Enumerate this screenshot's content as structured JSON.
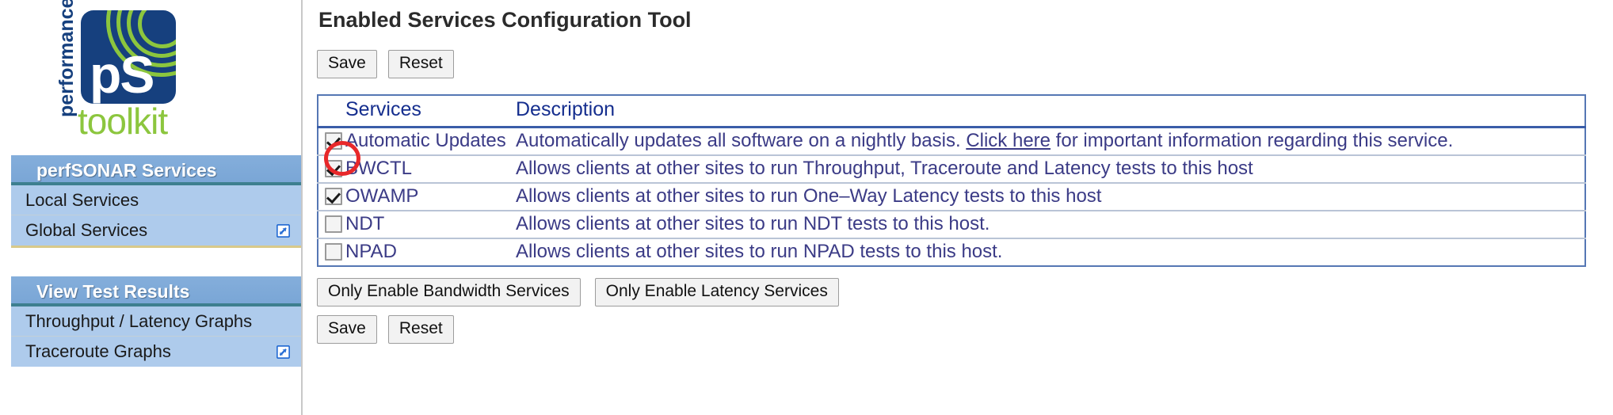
{
  "logo": {
    "vertical_text": "performance",
    "mark_text": "pS",
    "wordmark": "toolkit",
    "colors": {
      "navy": "#16407e",
      "green": "#8cc63e"
    }
  },
  "sidebar": {
    "sections": [
      {
        "header": "perfSONAR Services",
        "items": [
          {
            "label": "Local Services",
            "external": false,
            "icon": ""
          },
          {
            "label": "Global Services",
            "external": true,
            "icon": "external-link-icon"
          }
        ]
      },
      {
        "header": "View Test Results",
        "items": [
          {
            "label": "Throughput / Latency Graphs",
            "external": false,
            "icon": ""
          },
          {
            "label": "Traceroute Graphs",
            "external": true,
            "icon": "external-link-icon"
          }
        ]
      }
    ],
    "colors": {
      "header_bg": "#7aa6d6",
      "item_bg": "#aecbec",
      "rule": "#3d7f8f"
    }
  },
  "main": {
    "title": "Enabled Services Configuration Tool",
    "top_buttons": [
      {
        "label": "Save"
      },
      {
        "label": "Reset"
      }
    ],
    "table": {
      "headers": {
        "services": "Services",
        "description": "Description"
      },
      "rows": [
        {
          "checked": true,
          "name": "Automatic Updates",
          "desc_before": "Automatically updates all software on a nightly basis. ",
          "link": "Click here",
          "desc_after": " for important information regarding this service.",
          "annotated": true
        },
        {
          "checked": true,
          "name": "BWCTL",
          "desc_before": "Allows clients at other sites to run Throughput, Traceroute and Latency tests to this host",
          "link": "",
          "desc_after": "",
          "annotated": false
        },
        {
          "checked": true,
          "name": "OWAMP",
          "desc_before": "Allows clients at other sites to run One–Way Latency tests to this host",
          "link": "",
          "desc_after": "",
          "annotated": false
        },
        {
          "checked": false,
          "name": "NDT",
          "desc_before": "Allows clients at other sites to run NDT tests to this host.",
          "link": "",
          "desc_after": "",
          "annotated": false
        },
        {
          "checked": false,
          "name": "NPAD",
          "desc_before": "Allows clients at other sites to run NPAD tests to this host.",
          "link": "",
          "desc_after": "",
          "annotated": false
        }
      ],
      "colors": {
        "border": "#5577b4",
        "header_text": "#152e8e",
        "body_text": "#3b3b86"
      }
    },
    "preset_buttons": [
      {
        "label": "Only Enable Bandwidth Services"
      },
      {
        "label": "Only Enable Latency Services"
      }
    ],
    "bottom_buttons": [
      {
        "label": "Save"
      },
      {
        "label": "Reset"
      }
    ]
  },
  "annotation": {
    "shape": "ellipse",
    "color": "#e8282a",
    "target": "automatic-updates-checkbox"
  }
}
